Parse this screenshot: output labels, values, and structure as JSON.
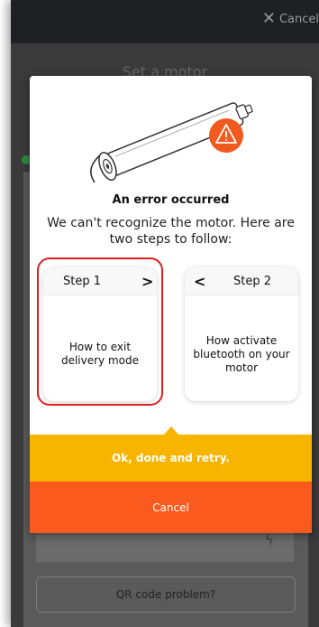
{
  "header": {
    "cancel_label": "Cancel",
    "close_icon": "close-icon"
  },
  "background": {
    "title": "Set a motor",
    "qr_button_label": "QR code problem?"
  },
  "modal": {
    "title": "An error occurred",
    "message": "We can't recognize the motor. Here are two steps to follow:",
    "steps": [
      {
        "label": "Step 1",
        "text": "How to exit delivery mode",
        "nav_icon": "chevron-right-icon"
      },
      {
        "label": "Step 2",
        "text": "How activate bluetooth on your motor",
        "nav_icon": "chevron-left-icon"
      }
    ],
    "primary_button": "Ok, done and retry.",
    "cancel_button": "Cancel"
  },
  "colors": {
    "primary": "#f7b500",
    "cancel": "#fb5a1e",
    "warning": "#f05a1e",
    "highlight": "#e01f1f"
  }
}
